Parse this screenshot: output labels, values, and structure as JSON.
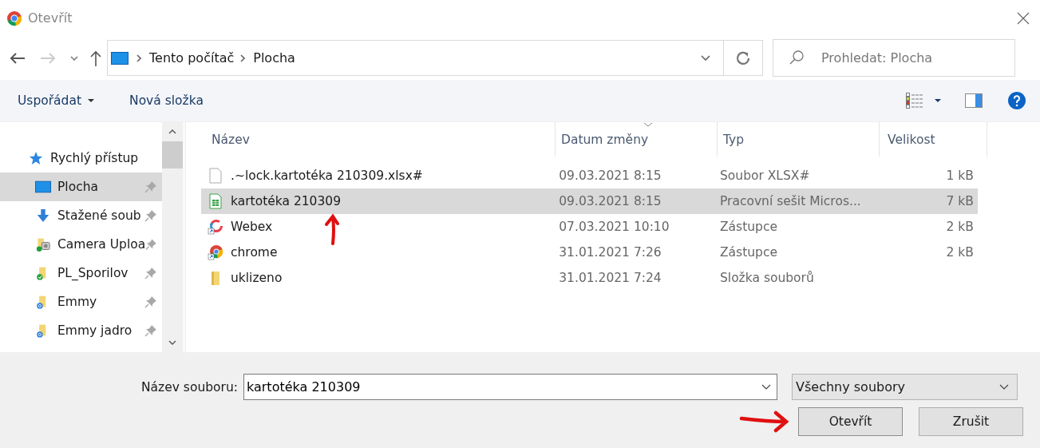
{
  "window": {
    "title": "Otevřít"
  },
  "nav": {
    "path": [
      "Tento počítač",
      "Plocha"
    ],
    "search": {
      "placeholder": "Prohledat: Plocha"
    }
  },
  "toolbar": {
    "items": [
      {
        "label": "Uspořádat",
        "kind": "dropdown"
      },
      {
        "label": "Nová složka",
        "kind": "plain"
      }
    ]
  },
  "sidebar": {
    "items": [
      {
        "label": "Rychlý přístup",
        "kind": "quick",
        "selected": false,
        "pinned": false
      },
      {
        "label": "Plocha",
        "kind": "desktop",
        "selected": true,
        "pinned": true
      },
      {
        "label": "Stažené soub",
        "kind": "download",
        "selected": false,
        "pinned": true
      },
      {
        "label": "Camera Uploa",
        "kind": "camera",
        "selected": false,
        "pinned": true
      },
      {
        "label": "PL_Sporilov",
        "kind": "synced",
        "selected": false,
        "pinned": true
      },
      {
        "label": "Emmy",
        "kind": "syncing",
        "selected": false,
        "pinned": true
      },
      {
        "label": "Emmy jadro",
        "kind": "syncing",
        "selected": false,
        "pinned": true
      }
    ]
  },
  "table": {
    "columns": [
      "Název",
      "Datum změny",
      "Typ",
      "Velikost"
    ],
    "rows": [
      {
        "kind": "blank",
        "name": ".~lock.kartotéka 210309.xlsx#",
        "date": "09.03.2021 8:15",
        "type": "Soubor XLSX#",
        "size": "1 kB",
        "selected": false
      },
      {
        "kind": "sheet",
        "name": "kartotéka 210309",
        "date": "09.03.2021 8:15",
        "type": "Pracovní sešit Micros...",
        "size": "7 kB",
        "selected": true
      },
      {
        "kind": "ring",
        "name": "Webex",
        "date": "07.03.2021 10:10",
        "type": "Zástupce",
        "size": "2 kB",
        "selected": false
      },
      {
        "kind": "browser",
        "name": "chrome",
        "date": "31.01.2021 7:26",
        "type": "Zástupce",
        "size": "2 kB",
        "selected": false
      },
      {
        "kind": "folder",
        "name": "uklizeno",
        "date": "31.01.2021 7:24",
        "type": "Složka souborů",
        "selected": false
      }
    ]
  },
  "footer": {
    "filename_label": "Název souboru:",
    "filename": "kartotéka 210309",
    "filetype": "Všechny soubory",
    "buttons": [
      "Otevřít",
      "Zrušit"
    ]
  }
}
